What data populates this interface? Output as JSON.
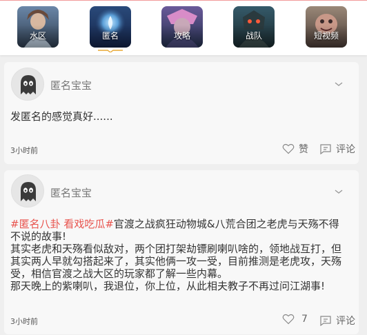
{
  "tabs": [
    {
      "label": "水区",
      "icon": "water-zone-thumbnail",
      "colors": [
        "#6b87a8",
        "#2f3d4f"
      ]
    },
    {
      "label": "匿名",
      "icon": "anonymous-thumbnail",
      "colors": [
        "#5b9fd8",
        "#14244a"
      ],
      "active": true
    },
    {
      "label": "攻略",
      "icon": "strategy-thumbnail",
      "colors": [
        "#6a5a9a",
        "#24304e"
      ]
    },
    {
      "label": "战队",
      "icon": "team-thumbnail",
      "colors": [
        "#355a6a",
        "#1a2a2e"
      ]
    },
    {
      "label": "短视频",
      "icon": "short-video-thumbnail",
      "colors": [
        "#9a8878",
        "#4a3c36"
      ]
    }
  ],
  "posts": [
    {
      "author": "匿名宝宝",
      "content": "发匿名的感觉真好......",
      "time": "3小时前",
      "like_label": "赞",
      "comment_label": "评论"
    },
    {
      "author": "匿名宝宝",
      "tags": "#匿名八卦 看戏吃瓜#",
      "content_line1": "官渡之战疯狂动物城&八荒合团之老虎与天殇不得",
      "content_line2": "不说的故事!",
      "content_line3": "其实老虎和天殇看似敌对，两个团打架劫镖刷喇叭啥的，领地战互打，但",
      "content_line4": "其实两人早就勾搭起来了，其实他俩一攻一受，目前推测是老虎攻，天殇",
      "content_line5": "受，相信官渡之战大区的玩家都了解一些内幕。",
      "content_line6": "那天晚上的紫喇叭，我退位，你上位，从此相夫教子不再过问江湖事!",
      "time": "3小时前",
      "like_count": "7",
      "comment_label": "评论"
    }
  ],
  "colors": {
    "tag": "#e8534d",
    "background": "#efefef",
    "card": "#f8f8f8",
    "active_underline": "#e8a834"
  }
}
